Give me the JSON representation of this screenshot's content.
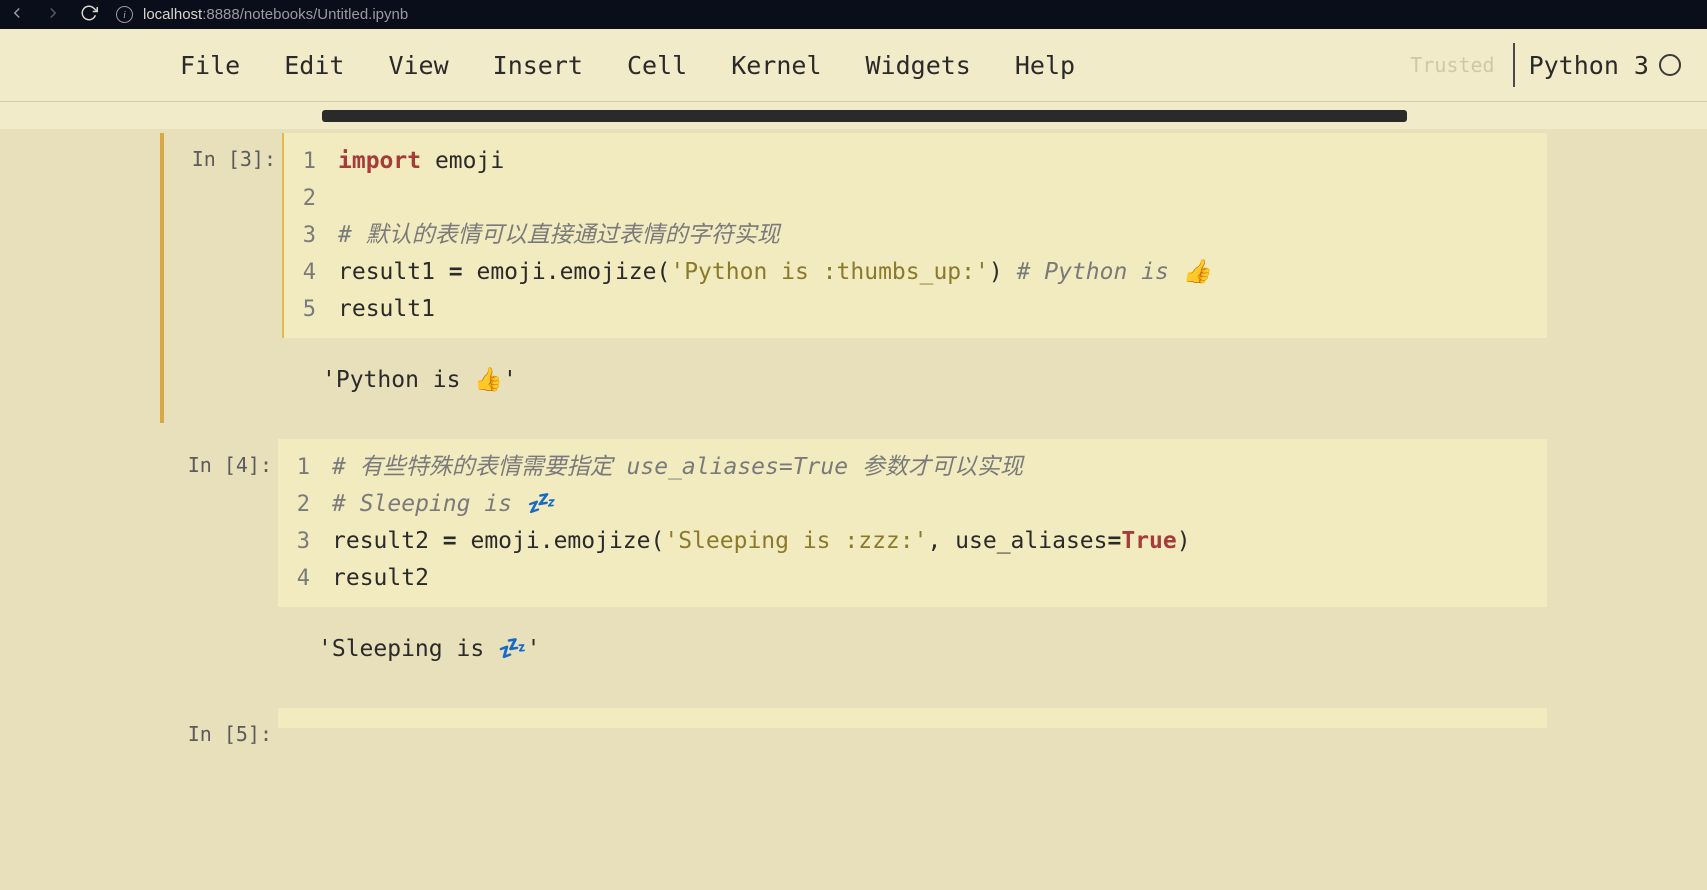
{
  "browser": {
    "url_host": "localhost",
    "url_path": ":8888/notebooks/Untitled.ipynb"
  },
  "menubar": {
    "file": "File",
    "edit": "Edit",
    "view": "View",
    "insert": "Insert",
    "cell": "Cell",
    "kernel": "Kernel",
    "widgets": "Widgets",
    "help": "Help",
    "trusted": "Trusted",
    "kernel_name": "Python 3"
  },
  "cells": [
    {
      "prompt": "In [3]:",
      "lines": [
        {
          "n": "1",
          "html": "<span class='tk-import'>import</span> emoji"
        },
        {
          "n": "2",
          "html": ""
        },
        {
          "n": "3",
          "html": "<span class='tk-cmt'># 默认的表情可以直接通过表情的字符实现</span>"
        },
        {
          "n": "4",
          "html": "result1 <span class='tk-op'>=</span> emoji.emojize(<span class='tk-str'>'Python is :thumbs_up:'</span>) <span class='tk-cmt'># Python is 👍</span>"
        },
        {
          "n": "5",
          "html": "result1"
        }
      ],
      "output": "'Python is 👍'"
    },
    {
      "prompt": "In [4]:",
      "lines": [
        {
          "n": "1",
          "html": "<span class='tk-cmt'># 有些特殊的表情需要指定 use_aliases=True 参数才可以实现</span>"
        },
        {
          "n": "2",
          "html": "<span class='tk-cmt'># Sleeping is 💤</span>"
        },
        {
          "n": "3",
          "html": "result2 <span class='tk-op'>=</span> emoji.emojize(<span class='tk-str'>'Sleeping is :zzz:'</span>, use_aliases<span class='tk-op'>=</span><span class='tk-bool'>True</span>)"
        },
        {
          "n": "4",
          "html": "result2"
        }
      ],
      "output": "'Sleeping is 💤'"
    },
    {
      "prompt": "In [5]:",
      "lines": [],
      "output": null
    }
  ]
}
